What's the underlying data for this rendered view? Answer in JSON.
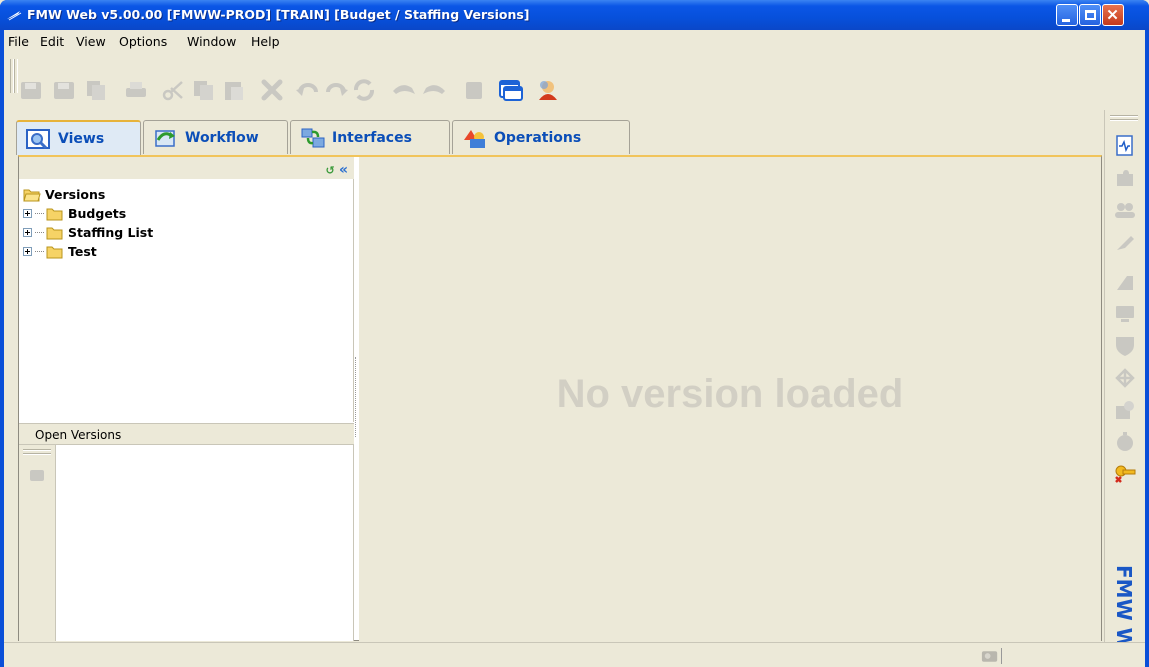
{
  "window": {
    "title": "FMW Web v5.00.00 [FMWW-PROD] [TRAIN] [Budget / Staffing Versions]",
    "controls": [
      "minimize-icon",
      "maximize-icon",
      "close-icon"
    ]
  },
  "menu": {
    "items": [
      "File",
      "Edit",
      "View",
      "Options",
      "Window",
      "Help"
    ]
  },
  "toolbar": {
    "icons": [
      "save-all-icon",
      "save-icon",
      "copy-doc-icon",
      "print-icon",
      "cut-icon",
      "copy-icon",
      "paste-icon",
      "delete-icon",
      "undo-icon",
      "redo-icon",
      "refresh-icon",
      "back-icon",
      "forward-icon",
      "calculator-icon",
      "window-icon",
      "user-icon"
    ]
  },
  "tabs": [
    {
      "label": "Views",
      "icon": "views-icon",
      "active": true
    },
    {
      "label": "Workflow",
      "icon": "workflow-icon",
      "active": false
    },
    {
      "label": "Interfaces",
      "icon": "interfaces-icon",
      "active": false
    },
    {
      "label": "Operations",
      "icon": "operations-icon",
      "active": false
    }
  ],
  "tree": {
    "root": "Versions",
    "children": [
      "Budgets",
      "Staffing List",
      "Test"
    ]
  },
  "open_versions": {
    "label": "Open Versions"
  },
  "content": {
    "placeholder": "No version loaded"
  },
  "right_sidebar": {
    "icons": [
      "report-icon",
      "puzzle-icon",
      "users-icon",
      "tool-icon",
      "stamp-icon",
      "monitor-icon",
      "shield-icon",
      "network-icon",
      "checklist-icon",
      "clock-icon",
      "keys-icon"
    ],
    "brand": "FMW W"
  },
  "colors": {
    "titlebar": "#0a56e6",
    "tab_text": "#0b4eb8",
    "placeholder": "#d2cfc4",
    "active_tab_accent": "#e7b33b"
  }
}
